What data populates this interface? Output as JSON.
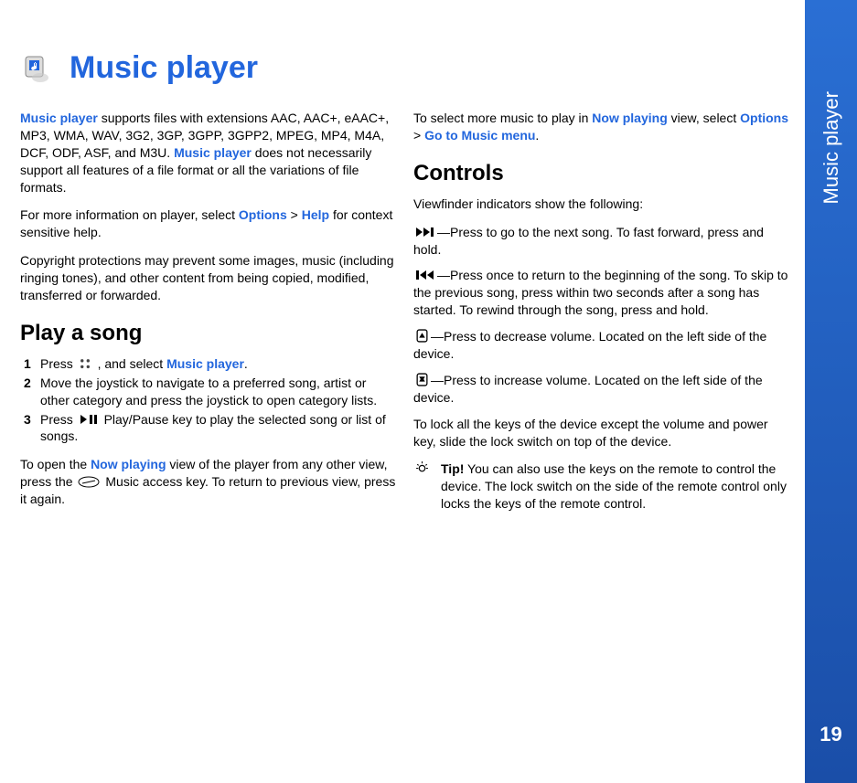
{
  "page_number": "19",
  "sidebar_label": "Music player",
  "title": "Music player",
  "intro": {
    "t1a": "Music player",
    "t1b": " supports files with extensions AAC, AAC+, eAAC+, MP3, WMA, WAV, 3G2, 3GP, 3GPP, 3GPP2, MPEG, MP4, M4A, DCF, ODF, ASF,  and M3U. ",
    "t1c": "Music player",
    "t1d": " does not necessarily support all features of a file format or all the variations of file formats.",
    "t2a": "For more information on player, select ",
    "t2b": "Options",
    "t2c": " > ",
    "t2d": "Help",
    "t2e": " for context sensitive help.",
    "t3": "Copyright protections may prevent some images, music (including ringing tones), and other content from being copied, modified, transferred or forwarded."
  },
  "play_song": {
    "heading": "Play a song",
    "s1a": "Press ",
    "s1b": " , and select ",
    "s1c": "Music player",
    "s1d": ".",
    "s2": "Move the joystick to navigate to a preferred song, artist or other category and press the joystick to open category lists.",
    "s3a": "Press ",
    "s3b": " Play/Pause key to play the selected song or list of songs.",
    "after_a": "To open the ",
    "after_b": "Now playing",
    "after_c": " view of the player from any other view, press the ",
    "after_d": " Music access key. To return to previous view, press it again."
  },
  "col2": {
    "sel1a": "To select more music to play in ",
    "sel1b": "Now playing",
    "sel1c": " view, select ",
    "sel1d": "Options",
    "sel1e": " > ",
    "sel1f": "Go to Music menu",
    "sel1g": "."
  },
  "controls": {
    "heading": "Controls",
    "lead": "Viewfinder indicators show the following:",
    "c1": "—Press to go to the next song. To fast forward, press and hold.",
    "c2": "—Press once to return to the beginning of the song. To skip to the previous song, press within two seconds after a song has started. To rewind through the song, press and hold.",
    "c3": "—Press to decrease volume. Located on the left side of the device.",
    "c4": "—Press to increase volume. Located on the left side of the device.",
    "lock": "To lock all the keys of the device except the volume and power key, slide the lock switch on top of the device.",
    "tip_label": "Tip!",
    "tip": " You can also use the keys on the remote to control the device. The lock switch on the side of the remote control only locks the keys of the remote control."
  }
}
